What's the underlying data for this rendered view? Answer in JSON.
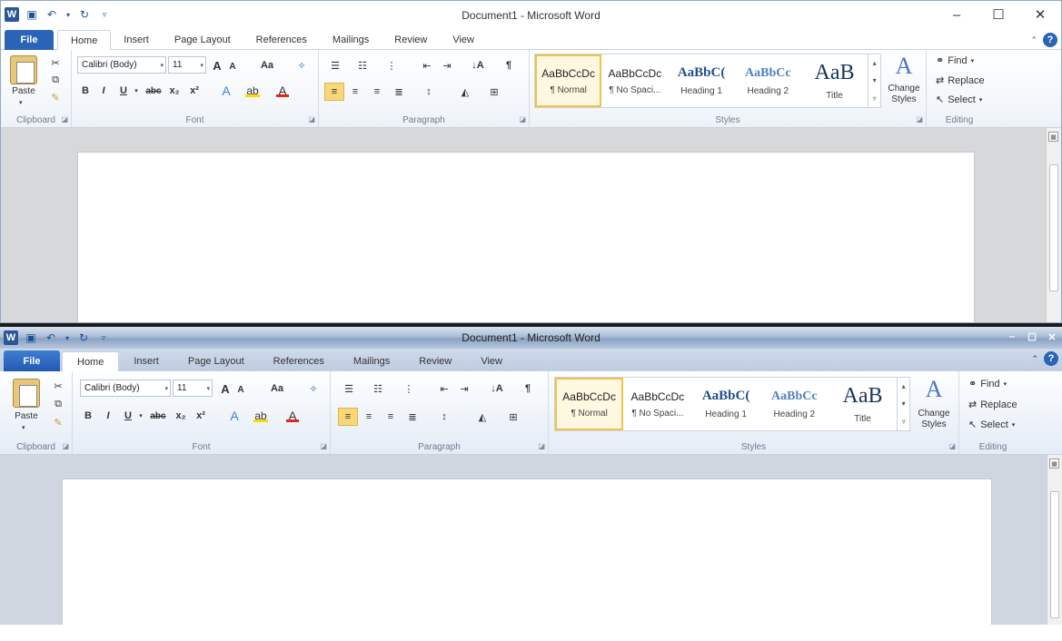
{
  "app": {
    "title": "Document1 - Microsoft Word"
  },
  "qat": {
    "logo": "W"
  },
  "window_controls": {
    "minimize": "–",
    "maximize": "☐",
    "close": "✕"
  },
  "file_tab": "File",
  "tabs": [
    "Home",
    "Insert",
    "Page Layout",
    "References",
    "Mailings",
    "Review",
    "View"
  ],
  "clipboard": {
    "paste": "Paste",
    "group_label": "Clipboard"
  },
  "font": {
    "name": "Calibri (Body)",
    "size": "11",
    "group_label": "Font",
    "change_case": "Aa"
  },
  "paragraph": {
    "group_label": "Paragraph",
    "pilcrow": "¶"
  },
  "styles": {
    "group_label": "Styles",
    "items": [
      {
        "preview": "AaBbCcDc",
        "name": "¶ Normal"
      },
      {
        "preview": "AaBbCcDc",
        "name": "¶ No Spaci..."
      },
      {
        "preview": "AaBbC(",
        "name": "Heading 1"
      },
      {
        "preview": "AaBbCc",
        "name": "Heading 2"
      },
      {
        "preview": "AaB",
        "name": "Title"
      }
    ],
    "change_styles_1": "Change",
    "change_styles_2": "Styles"
  },
  "editing": {
    "find": "Find",
    "replace": "Replace",
    "select": "Select",
    "group_label": "Editing"
  },
  "colors": {
    "accent": "#2a64b6",
    "highlight": "#ffd800",
    "font_color": "#e0281e",
    "selected_style": "#f0c24a"
  }
}
